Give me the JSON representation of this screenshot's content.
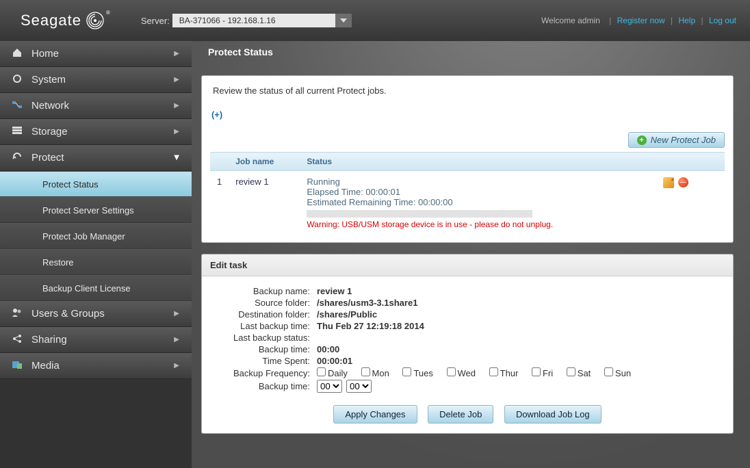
{
  "topbar": {
    "logo_text": "Seagate",
    "server_label": "Server:",
    "server_value": "BA-371066 - 192.168.1.16",
    "welcome": "Welcome admin",
    "register": "Register now",
    "help": "Help",
    "logout": "Log out"
  },
  "sidebar": {
    "items": [
      {
        "label": "Home",
        "icon": "home-icon"
      },
      {
        "label": "System",
        "icon": "gear-icon"
      },
      {
        "label": "Network",
        "icon": "network-icon"
      },
      {
        "label": "Storage",
        "icon": "storage-icon"
      },
      {
        "label": "Protect",
        "icon": "protect-icon",
        "expanded": true,
        "children": [
          {
            "label": "Protect Status",
            "active": true
          },
          {
            "label": "Protect Server Settings"
          },
          {
            "label": "Protect Job Manager"
          },
          {
            "label": "Restore"
          },
          {
            "label": "Backup Client License"
          }
        ]
      },
      {
        "label": "Users & Groups",
        "icon": "users-icon"
      },
      {
        "label": "Sharing",
        "icon": "share-icon"
      },
      {
        "label": "Media",
        "icon": "media-icon"
      }
    ]
  },
  "page": {
    "title": "Protect Status",
    "description": "Review the status of all current Protect jobs.",
    "expand_link": "(+)",
    "new_job_btn": "New Protect Job",
    "table": {
      "headers": {
        "jobname": "Job name",
        "status": "Status"
      },
      "rows": [
        {
          "num": "1",
          "jobname": "review 1",
          "status_line1": "Running",
          "status_line2": "Elapsed Time: 00:00:01",
          "status_line3": "Estimated Remaining Time: 00:00:00",
          "warning": "Warning: USB/USM storage device is in use - please do not unplug."
        }
      ]
    },
    "edit": {
      "section_title": "Edit task",
      "labels": {
        "backup_name": "Backup name:",
        "source": "Source folder:",
        "dest": "Destination folder:",
        "last_time": "Last backup time:",
        "last_status": "Last backup status:",
        "btime": "Backup time:",
        "time_spent": "Time Spent:",
        "freq": "Backup Frequency:",
        "btime2": "Backup time:"
      },
      "values": {
        "backup_name": "review 1",
        "source": "/shares/usm3-3.1share1",
        "dest": "/shares/Public",
        "last_time": "Thu Feb 27 12:19:18 2014",
        "last_status": "",
        "btime": "00:00",
        "time_spent": "00:00:01"
      },
      "freq_options": [
        "Daily",
        "Mon",
        "Tues",
        "Wed",
        "Thur",
        "Fri",
        "Sat",
        "Sun"
      ],
      "time_selects": {
        "hour": "00",
        "minute": "00"
      },
      "buttons": {
        "apply": "Apply Changes",
        "delete": "Delete Job",
        "download": "Download Job Log"
      }
    }
  }
}
